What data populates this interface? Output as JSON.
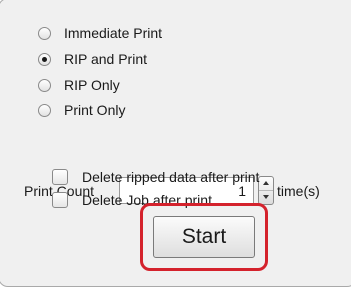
{
  "print_mode": {
    "options": [
      {
        "label": "Immediate Print",
        "selected": false
      },
      {
        "label": "RIP and Print",
        "selected": true
      },
      {
        "label": "RIP Only",
        "selected": false
      },
      {
        "label": "Print Only",
        "selected": false
      }
    ]
  },
  "print_count": {
    "label": "Print Count",
    "value": "1",
    "unit": "time(s)"
  },
  "options": {
    "delete_ripped_data": {
      "label": "Delete ripped data after print",
      "checked": false
    },
    "delete_job": {
      "label": "Delete Job after print",
      "checked": false
    }
  },
  "start_button": {
    "label": "Start"
  },
  "colors": {
    "highlight": "#d4222c",
    "panel_background": "#f0f0f0"
  }
}
